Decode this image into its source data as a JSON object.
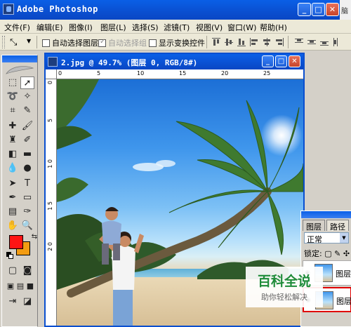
{
  "app": {
    "title": "Adobe Photoshop",
    "right_fragment": "脑"
  },
  "menu": [
    {
      "label": "文件(F)"
    },
    {
      "label": "编辑(E)"
    },
    {
      "label": "图像(I)"
    },
    {
      "label": "图层(L)"
    },
    {
      "label": "选择(S)"
    },
    {
      "label": "滤镜(T)"
    },
    {
      "label": "视图(V)"
    },
    {
      "label": "窗口(W)"
    },
    {
      "label": "帮助(H)"
    }
  ],
  "options": {
    "auto_select_layer": {
      "label": "自动选择图层",
      "checked": false
    },
    "auto_select_group": {
      "label": "自动选择组",
      "checked": true,
      "disabled": true
    },
    "show_transform": {
      "label": "显示变换控件",
      "checked": false
    }
  },
  "document": {
    "title": "2.jpg @ 49.7% (图层 0, RGB/8#)",
    "ruler_h": [
      "0",
      "5",
      "10",
      "15",
      "20",
      "25"
    ],
    "ruler_v": [
      "0",
      "5",
      "1\n0",
      "1\n5",
      "2\n0"
    ]
  },
  "colors": {
    "foreground": "#ff1414",
    "background": "#f39c12",
    "titlebar": "#0a4fd0"
  },
  "layers_panel": {
    "tabs": [
      "图层",
      "路径"
    ],
    "blend_mode": "正常",
    "lock_label": "锁定:",
    "layers": [
      {
        "name": "图层"
      },
      {
        "name": "图层"
      }
    ]
  },
  "watermark": {
    "title": "百科全说",
    "subtitle": "助你轻松解决"
  }
}
